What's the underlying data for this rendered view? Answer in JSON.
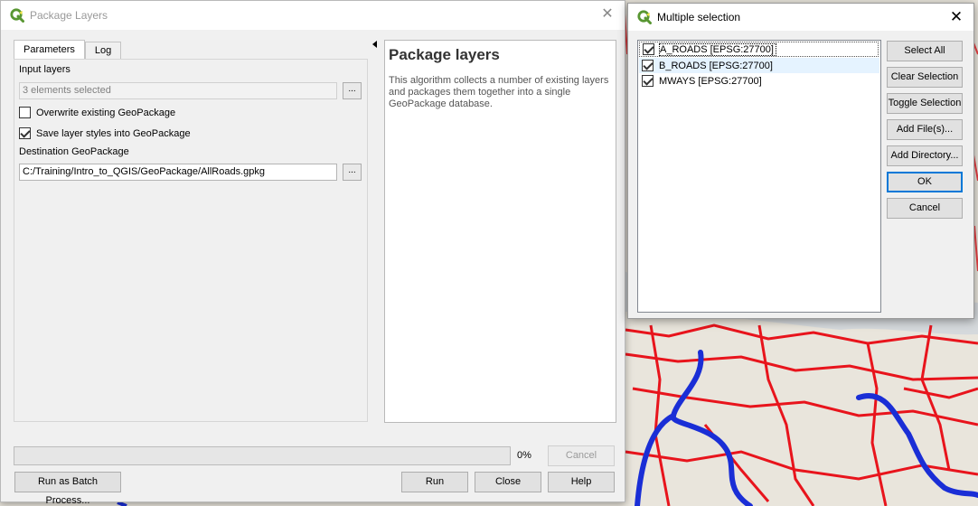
{
  "main_dialog": {
    "title": "Package Layers",
    "tabs": [
      "Parameters",
      "Log"
    ],
    "input_layers_label": "Input layers",
    "input_layers_value": "3 elements selected",
    "browse_label": "...",
    "overwrite_label": "Overwrite existing GeoPackage",
    "overwrite_checked": false,
    "save_styles_label": "Save layer styles into GeoPackage",
    "save_styles_checked": true,
    "destination_label": "Destination GeoPackage",
    "destination_value": "C:/Training/Intro_to_QGIS/GeoPackage/AllRoads.gpkg",
    "help_title": "Package layers",
    "help_text": "This algorithm collects a number of existing layers and packages them together into a single GeoPackage database.",
    "progress_percent": 0,
    "progress_text": "0%",
    "cancel_label": "Cancel",
    "batch_label": "Run as Batch Process...",
    "run_label": "Run",
    "close_label": "Close",
    "help_label": "Help"
  },
  "multi_dialog": {
    "title": "Multiple selection",
    "items": [
      {
        "label": "A_ROADS [EPSG:27700]",
        "checked": true
      },
      {
        "label": "B_ROADS [EPSG:27700]",
        "checked": true
      },
      {
        "label": "MWAYS [EPSG:27700]",
        "checked": true
      }
    ],
    "buttons": {
      "select_all": "Select All",
      "clear_selection": "Clear Selection",
      "toggle_selection": "Toggle Selection",
      "add_files": "Add File(s)...",
      "add_directory": "Add Directory...",
      "ok": "OK",
      "cancel": "Cancel"
    }
  },
  "colors": {
    "qgis_green": "#589632",
    "a_roads": "#e8141c",
    "motorways": "#1a2ed6",
    "map_base": "#e9e5dc"
  }
}
